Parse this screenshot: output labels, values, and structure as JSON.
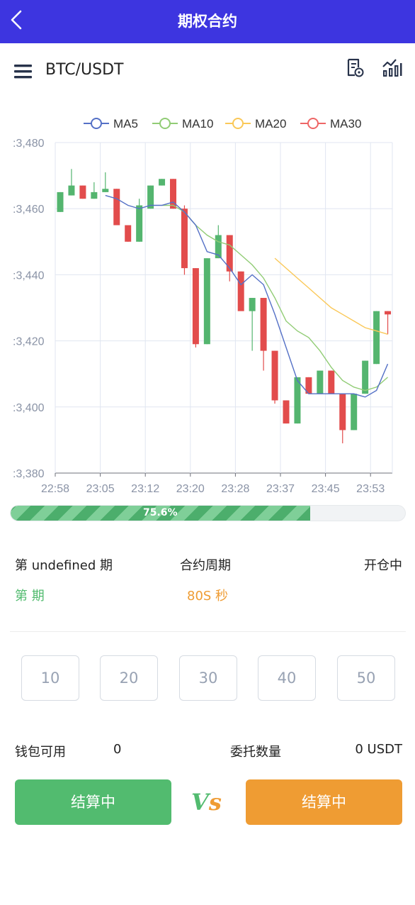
{
  "header": {
    "title": "期权合约"
  },
  "toolbar": {
    "pair": "BTC/USDT"
  },
  "chart_data": {
    "type": "candlestick",
    "legend": [
      "MA5",
      "MA10",
      "MA20",
      "MA30"
    ],
    "legend_colors": [
      "#5470c6",
      "#91cc75",
      "#fac858",
      "#ee6666"
    ],
    "ylim": [
      23380,
      23480
    ],
    "y_ticks": [
      ":3,380",
      ":3,400",
      ":3,420",
      ":3,440",
      ":3,460",
      ":3,480"
    ],
    "x_ticks": [
      "22:58",
      "23:05",
      "23:12",
      "23:20",
      "23:28",
      "23:37",
      "23:45",
      "23:53"
    ],
    "up_color": "#54b56f",
    "down_color": "#e24c4c",
    "candles": [
      {
        "o": 23459,
        "c": 23465,
        "h": 23465,
        "l": 23459
      },
      {
        "o": 23464,
        "c": 23467,
        "h": 23472,
        "l": 23464
      },
      {
        "o": 23467,
        "c": 23463,
        "h": 23467,
        "l": 23463
      },
      {
        "o": 23463,
        "c": 23465,
        "h": 23468,
        "l": 23463
      },
      {
        "o": 23465,
        "c": 23466,
        "h": 23471,
        "l": 23465
      },
      {
        "o": 23466,
        "c": 23455,
        "h": 23466,
        "l": 23455
      },
      {
        "o": 23455,
        "c": 23450,
        "h": 23455,
        "l": 23450
      },
      {
        "o": 23450,
        "c": 23461,
        "h": 23463,
        "l": 23450
      },
      {
        "o": 23460,
        "c": 23467,
        "h": 23467,
        "l": 23460
      },
      {
        "o": 23467,
        "c": 23469,
        "h": 23469,
        "l": 23467
      },
      {
        "o": 23469,
        "c": 23460,
        "h": 23469,
        "l": 23460
      },
      {
        "o": 23460,
        "c": 23442,
        "h": 23461,
        "l": 23440
      },
      {
        "o": 23442,
        "c": 23419,
        "h": 23442,
        "l": 23418
      },
      {
        "o": 23419,
        "c": 23445,
        "h": 23445,
        "l": 23419
      },
      {
        "o": 23445,
        "c": 23452,
        "h": 23455,
        "l": 23445
      },
      {
        "o": 23452,
        "c": 23441,
        "h": 23452,
        "l": 23438
      },
      {
        "o": 23441,
        "c": 23429,
        "h": 23441,
        "l": 23435
      },
      {
        "o": 23429,
        "c": 23433,
        "h": 23433,
        "l": 23417
      },
      {
        "o": 23433,
        "c": 23417,
        "h": 23433,
        "l": 23411
      },
      {
        "o": 23417,
        "c": 23402,
        "h": 23417,
        "l": 23401
      },
      {
        "o": 23402,
        "c": 23395,
        "h": 23402,
        "l": 23395
      },
      {
        "o": 23395,
        "c": 23409,
        "h": 23409,
        "l": 23395
      },
      {
        "o": 23409,
        "c": 23404,
        "h": 23409,
        "l": 23404
      },
      {
        "o": 23404,
        "c": 23411,
        "h": 23411,
        "l": 23404
      },
      {
        "o": 23411,
        "c": 23404,
        "h": 23411,
        "l": 23404
      },
      {
        "o": 23404,
        "c": 23393,
        "h": 23404,
        "l": 23389
      },
      {
        "o": 23393,
        "c": 23404,
        "h": 23404,
        "l": 23393
      },
      {
        "o": 23404,
        "c": 23414,
        "h": 23414,
        "l": 23404
      },
      {
        "o": 23413,
        "c": 23429,
        "h": 23429,
        "l": 23413
      },
      {
        "o": 23429,
        "c": 23428,
        "h": 23429,
        "l": 23422
      }
    ],
    "ma5": [
      null,
      null,
      null,
      null,
      23464,
      23463,
      23461,
      23460,
      23461,
      23461,
      23462,
      23459,
      23455,
      23447,
      23446,
      23442,
      23437,
      23440,
      23437,
      23428,
      23418,
      23408,
      23404,
      23404,
      23404,
      23404,
      23404,
      23403,
      23405,
      23413
    ],
    "ma10": [
      null,
      null,
      null,
      null,
      null,
      null,
      null,
      null,
      null,
      23461,
      23461,
      23459,
      23455,
      23452,
      23450,
      23449,
      23446,
      23443,
      23439,
      23433,
      23426,
      23423,
      23421,
      23417,
      23412,
      23408,
      23406,
      23405,
      23406,
      23409
    ],
    "ma20": [
      null,
      null,
      null,
      null,
      null,
      null,
      null,
      null,
      null,
      null,
      null,
      null,
      null,
      null,
      null,
      null,
      null,
      null,
      null,
      23445,
      23442,
      23439,
      23436,
      23433,
      23430,
      23428,
      23426,
      23424,
      23423,
      23422
    ],
    "ma30": []
  },
  "progress": {
    "value": 0.756,
    "label": "75.6%"
  },
  "info": {
    "period_label": "第 undefined 期",
    "cycle_label": "合约周期",
    "status": "开仓中",
    "period_value": "第 期",
    "cycle_value": "80S 秒"
  },
  "amounts": [
    "10",
    "20",
    "30",
    "40",
    "50"
  ],
  "wallet": {
    "label": "钱包可用",
    "value": "0",
    "entrust_label": "委托数量",
    "entrust_value": "0 USDT"
  },
  "buttons": {
    "left": "结算中",
    "right": "结算中"
  },
  "vs": {
    "v": "V",
    "s": "s"
  },
  "colors": {
    "header_bg": "#3d35e0",
    "green": "#52bb6f",
    "orange": "#ef9c33",
    "period_green": "#52bb6f",
    "cycle_orange": "#ef9c33"
  }
}
